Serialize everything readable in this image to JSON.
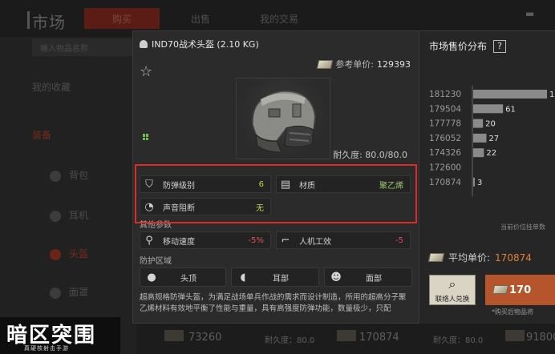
{
  "background": {
    "title": "市场",
    "tabs": [
      "购买",
      "出售",
      "我的交易"
    ],
    "subbar": "输入物品名称",
    "nav": [
      "我的收藏",
      "装备",
      "背包",
      "耳机",
      "头盔",
      "面罩"
    ],
    "currency_value": "",
    "bottom_prices": [
      "73260",
      "170874",
      "91800"
    ],
    "bottom_labels": [
      "耐久度：80.0",
      "耐久度：80.0"
    ]
  },
  "item": {
    "name": "IND70战术头盔 (2.10 KG)",
    "ref_label": "参考单价:",
    "ref_price": "129393",
    "durability": "耐久度: 80.0/80.0",
    "attributes": [
      {
        "label": "防弹级别",
        "value": "6",
        "icon": "shield-icon",
        "color": "#c8cf5a"
      },
      {
        "label": "材质",
        "value": "聚乙烯",
        "icon": "material-icon",
        "color": "#9ec86a"
      },
      {
        "label": "声音阻断",
        "value": "无",
        "icon": "ear-muted-icon",
        "color": "#c8cf5a"
      }
    ],
    "other_label": "其他参数",
    "other_params": [
      {
        "label": "移动速度",
        "value": "-5%",
        "icon": "running-icon"
      },
      {
        "label": "人机工效",
        "value": "-5",
        "icon": "pistol-icon"
      }
    ],
    "protection_label": "防护区域",
    "zones": [
      {
        "label": "头顶",
        "icon": "head-top-icon"
      },
      {
        "label": "耳部",
        "icon": "ear-icon"
      },
      {
        "label": "面部",
        "icon": "face-icon"
      }
    ],
    "description": "超高规格防弹头盔，为满足战场单兵作战的需求而设计制造，所用的超高分子聚乙烯材料有效地平衡了性能与重量，具有高强度防弹功能，数量极少，只配"
  },
  "market": {
    "title": "市场售价分布",
    "help": "?",
    "axis_caption": "当前价位挂单数",
    "avg_label": "平均单价:",
    "avg_value": "170874",
    "exchange_label": "联络人兑换",
    "buy_price": "170",
    "buy_note": "*购买后物品将"
  },
  "chart_data": {
    "type": "bar",
    "orientation": "horizontal",
    "categories": [
      "181230",
      "179504",
      "177778",
      "176052",
      "174326",
      "172600",
      "170874"
    ],
    "values": [
      151,
      61,
      20,
      27,
      22,
      null,
      3
    ],
    "xlabel": "当前价位挂单数",
    "ylabel": ""
  },
  "watermark": {
    "title": "暗区突围",
    "subtitle": "真硬核射击手游"
  },
  "colors": {
    "highlight": "#e02a2a",
    "accent_orange": "#e07f3a",
    "buy_button": "#b6542b",
    "value_green": "#9ec86a",
    "value_yellow": "#c8cf5a",
    "value_red": "#e05252"
  }
}
